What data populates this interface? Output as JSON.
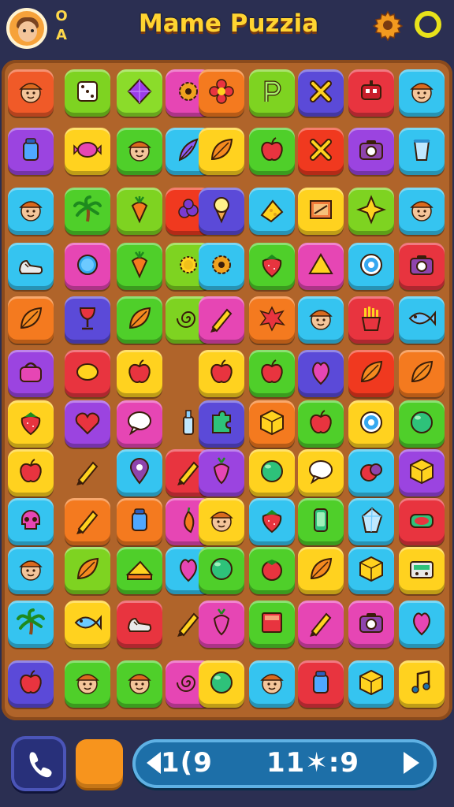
{
  "header": {
    "avatar_icon": "boy-avatar-icon",
    "corner_text_top": "O",
    "corner_text_bottom": "A",
    "title": "Mame Puzzia",
    "settings_icon": "gear-icon",
    "ring_icon": "ring-icon"
  },
  "colors": {
    "background": "#2b2f52",
    "board": "#b0642a",
    "title": "#ffd431",
    "status_bar": "#1d6fa8",
    "orange_button": "#f7941d"
  },
  "board": {
    "rows": [
      [
        {
          "color": "#f05a28",
          "icon": "boy-face"
        },
        {
          "color": "#7ed321",
          "icon": "dice"
        },
        {
          "color": "#8bdc2a",
          "icon": "diamond-gem"
        },
        {
          "color": "#e646b4",
          "icon": "gear"
        },
        {
          "color": "#f47a1f",
          "icon": "flower"
        },
        {
          "color": "#7ed321",
          "icon": "p-letter"
        },
        {
          "color": "#5b4ad8",
          "icon": "x-mark"
        },
        {
          "color": "#e8343f",
          "icon": "robot"
        },
        {
          "color": "#35c4f0",
          "icon": "boy-face"
        }
      ],
      [
        {
          "color": "#9b44e0",
          "icon": "jar"
        },
        {
          "color": "#ffd21f",
          "icon": "candy"
        },
        {
          "color": "#4fcf2a",
          "icon": "boy-face"
        },
        {
          "color": "#35c4f0",
          "icon": "feather"
        },
        {
          "color": "#ffd21f",
          "icon": "leaf"
        },
        {
          "color": "#4fcf2a",
          "icon": "apple"
        },
        {
          "color": "#f0391f",
          "icon": "x-mark"
        },
        {
          "color": "#9b44e0",
          "icon": "camera"
        },
        {
          "color": "#35c4f0",
          "icon": "cup"
        }
      ],
      [
        {
          "color": "#35c4f0",
          "icon": "boy-face"
        },
        {
          "color": "#4fcf2a",
          "icon": "palm-tree"
        },
        {
          "color": "#7ed321",
          "icon": "carrot"
        },
        {
          "color": "#f0391f",
          "icon": "berry"
        },
        {
          "color": "#5b4ad8",
          "icon": "ice-cream"
        },
        {
          "color": "#35c4f0",
          "icon": "cheese"
        },
        {
          "color": "#ffd21f",
          "icon": "frame"
        },
        {
          "color": "#7ed321",
          "icon": "star-diamond"
        },
        {
          "color": "#35c4f0",
          "icon": "boy-face"
        }
      ],
      [
        {
          "color": "#35c4f0",
          "icon": "shoe"
        },
        {
          "color": "#e646b4",
          "icon": "ring"
        },
        {
          "color": "#4fcf2a",
          "icon": "carrot"
        },
        {
          "color": "#7ed321",
          "icon": "sun"
        },
        {
          "color": "#35c4f0",
          "icon": "gear"
        },
        {
          "color": "#4fcf2a",
          "icon": "strawberry"
        },
        {
          "color": "#e646b4",
          "icon": "triangle"
        },
        {
          "color": "#35c4f0",
          "icon": "target"
        },
        {
          "color": "#e8343f",
          "icon": "camera"
        }
      ],
      [
        {
          "color": "#f47a1f",
          "icon": "leaf"
        },
        {
          "color": "#5b4ad8",
          "icon": "glass"
        },
        {
          "color": "#4fcf2a",
          "icon": "leaf"
        },
        {
          "color": "#7ed321",
          "icon": "spiral"
        },
        {
          "color": "#e646b4",
          "icon": "pencil"
        },
        {
          "color": "#f47a1f",
          "icon": "splat"
        },
        {
          "color": "#35c4f0",
          "icon": "boy-face"
        },
        {
          "color": "#e8343f",
          "icon": "fries"
        },
        {
          "color": "#35c4f0",
          "icon": "fish"
        }
      ],
      [
        {
          "color": "#9b44e0",
          "icon": "purse"
        },
        {
          "color": "#e8343f",
          "icon": "lemon"
        },
        {
          "color": "#ffd21f",
          "icon": "apple"
        },
        {
          "color": "empty",
          "icon": "empty"
        },
        {
          "color": "#ffd21f",
          "icon": "apple"
        },
        {
          "color": "#4fcf2a",
          "icon": "apple"
        },
        {
          "color": "#5b4ad8",
          "icon": "heart-drop"
        },
        {
          "color": "#f0391f",
          "icon": "leaf"
        },
        {
          "color": "#f47a1f",
          "icon": "leaf"
        }
      ],
      [
        {
          "color": "#ffd21f",
          "icon": "strawberry"
        },
        {
          "color": "#9b44e0",
          "icon": "heart"
        },
        {
          "color": "#e646b4",
          "icon": "chat-bubble"
        },
        {
          "color": "empty",
          "icon": "bottle"
        },
        {
          "color": "#5b4ad8",
          "icon": "puzzle"
        },
        {
          "color": "#f47a1f",
          "icon": "cube"
        },
        {
          "color": "#4fcf2a",
          "icon": "apple"
        },
        {
          "color": "#ffd21f",
          "icon": "target"
        },
        {
          "color": "#4fcf2a",
          "icon": "ball"
        }
      ],
      [
        {
          "color": "#ffd21f",
          "icon": "apple"
        },
        {
          "color": "empty",
          "icon": "pencil"
        },
        {
          "color": "#35c4f0",
          "icon": "pin"
        },
        {
          "color": "#e8343f",
          "icon": "pencil"
        },
        {
          "color": "#9b44e0",
          "icon": "radish"
        },
        {
          "color": "#ffd21f",
          "icon": "ball"
        },
        {
          "color": "#ffd21f",
          "icon": "chat-bubble"
        },
        {
          "color": "#35c4f0",
          "icon": "fruit"
        },
        {
          "color": "#9b44e0",
          "icon": "cube"
        }
      ],
      [
        {
          "color": "#35c4f0",
          "icon": "skull"
        },
        {
          "color": "#f47a1f",
          "icon": "pencil"
        },
        {
          "color": "#f47a1f",
          "icon": "jar"
        },
        {
          "color": "#e646b4",
          "icon": "pepper"
        },
        {
          "color": "#ffd21f",
          "icon": "boy-face"
        },
        {
          "color": "#35c4f0",
          "icon": "strawberry"
        },
        {
          "color": "#4fcf2a",
          "icon": "phone"
        },
        {
          "color": "#35c4f0",
          "icon": "crystal"
        },
        {
          "color": "#e8343f",
          "icon": "sushi"
        }
      ],
      [
        {
          "color": "#35c4f0",
          "icon": "boy-face"
        },
        {
          "color": "#7ed321",
          "icon": "leaf"
        },
        {
          "color": "#4fcf2a",
          "icon": "cake"
        },
        {
          "color": "#35c4f0",
          "icon": "heart-drop"
        },
        {
          "color": "#4fcf2a",
          "icon": "ball"
        },
        {
          "color": "#4fcf2a",
          "icon": "tomato"
        },
        {
          "color": "#ffd21f",
          "icon": "leaf"
        },
        {
          "color": "#35c4f0",
          "icon": "cube"
        },
        {
          "color": "#ffd21f",
          "icon": "radio"
        }
      ],
      [
        {
          "color": "#35c4f0",
          "icon": "palm-tree"
        },
        {
          "color": "#ffd21f",
          "icon": "fish"
        },
        {
          "color": "#e8343f",
          "icon": "shoe"
        },
        {
          "color": "empty",
          "icon": "pencil"
        },
        {
          "color": "#e646b4",
          "icon": "radish"
        },
        {
          "color": "#4fcf2a",
          "icon": "book"
        },
        {
          "color": "#e646b4",
          "icon": "pencil"
        },
        {
          "color": "#e646b4",
          "icon": "camera"
        },
        {
          "color": "#35c4f0",
          "icon": "heart-drop"
        }
      ],
      [
        {
          "color": "#5b4ad8",
          "icon": "apple"
        },
        {
          "color": "#4fcf2a",
          "icon": "boy-face"
        },
        {
          "color": "#4fcf2a",
          "icon": "boy-face"
        },
        {
          "color": "#e646b4",
          "icon": "spiral"
        },
        {
          "color": "#ffd21f",
          "icon": "ball"
        },
        {
          "color": "#35c4f0",
          "icon": "boy-face"
        },
        {
          "color": "#e8343f",
          "icon": "jar"
        },
        {
          "color": "#35c4f0",
          "icon": "cube"
        },
        {
          "color": "#ffd21f",
          "icon": "note"
        }
      ]
    ]
  },
  "footer": {
    "phone_icon": "phone-icon",
    "left_arrow_icon": "arrow-left-icon",
    "status_left": "1(9",
    "status_right": "11✶:9",
    "right_arrow_icon": "play-arrow-icon"
  }
}
